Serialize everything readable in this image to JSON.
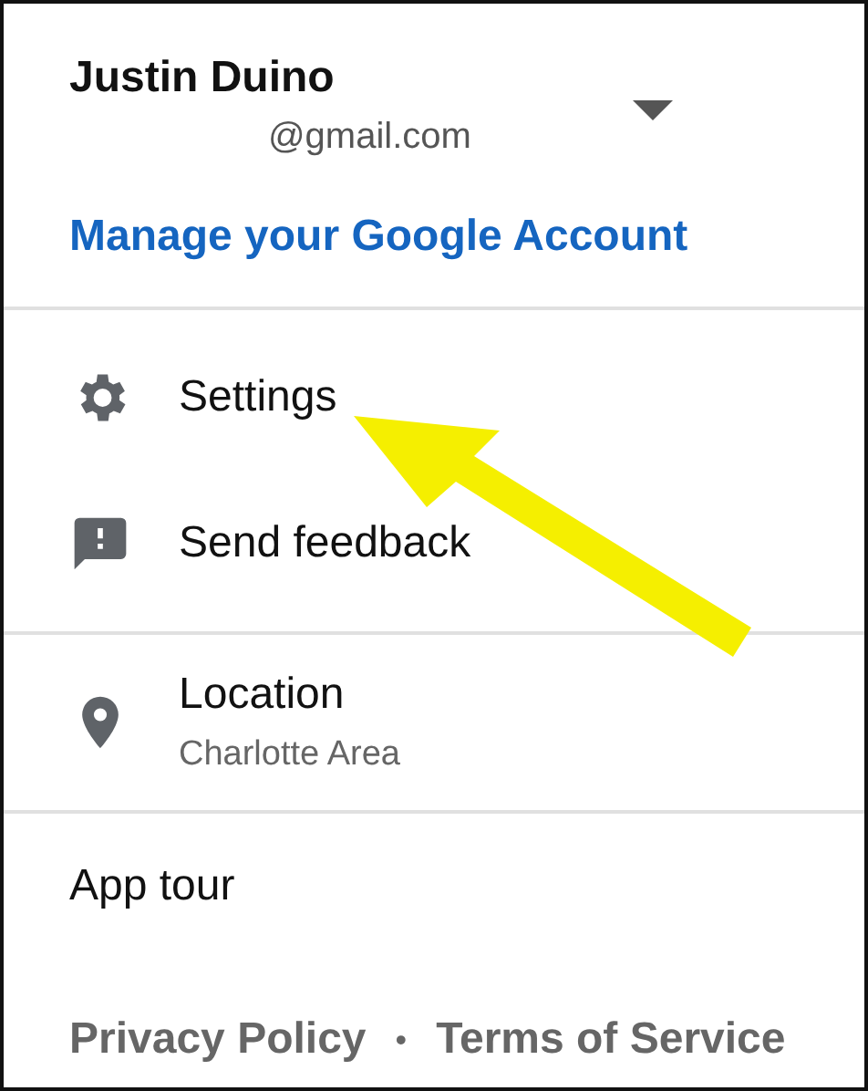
{
  "account": {
    "name": "Justin Duino",
    "email": "@gmail.com",
    "manage_link": "Manage your Google Account"
  },
  "menu": [
    {
      "kind": "settings",
      "label": "Settings"
    },
    {
      "kind": "feedback",
      "label": "Send feedback"
    }
  ],
  "location": {
    "label": "Location",
    "value": "Charlotte Area"
  },
  "app_tour": "App tour",
  "footer": {
    "links": [
      "Privacy Policy",
      "Terms of Service"
    ],
    "separator": "•"
  }
}
